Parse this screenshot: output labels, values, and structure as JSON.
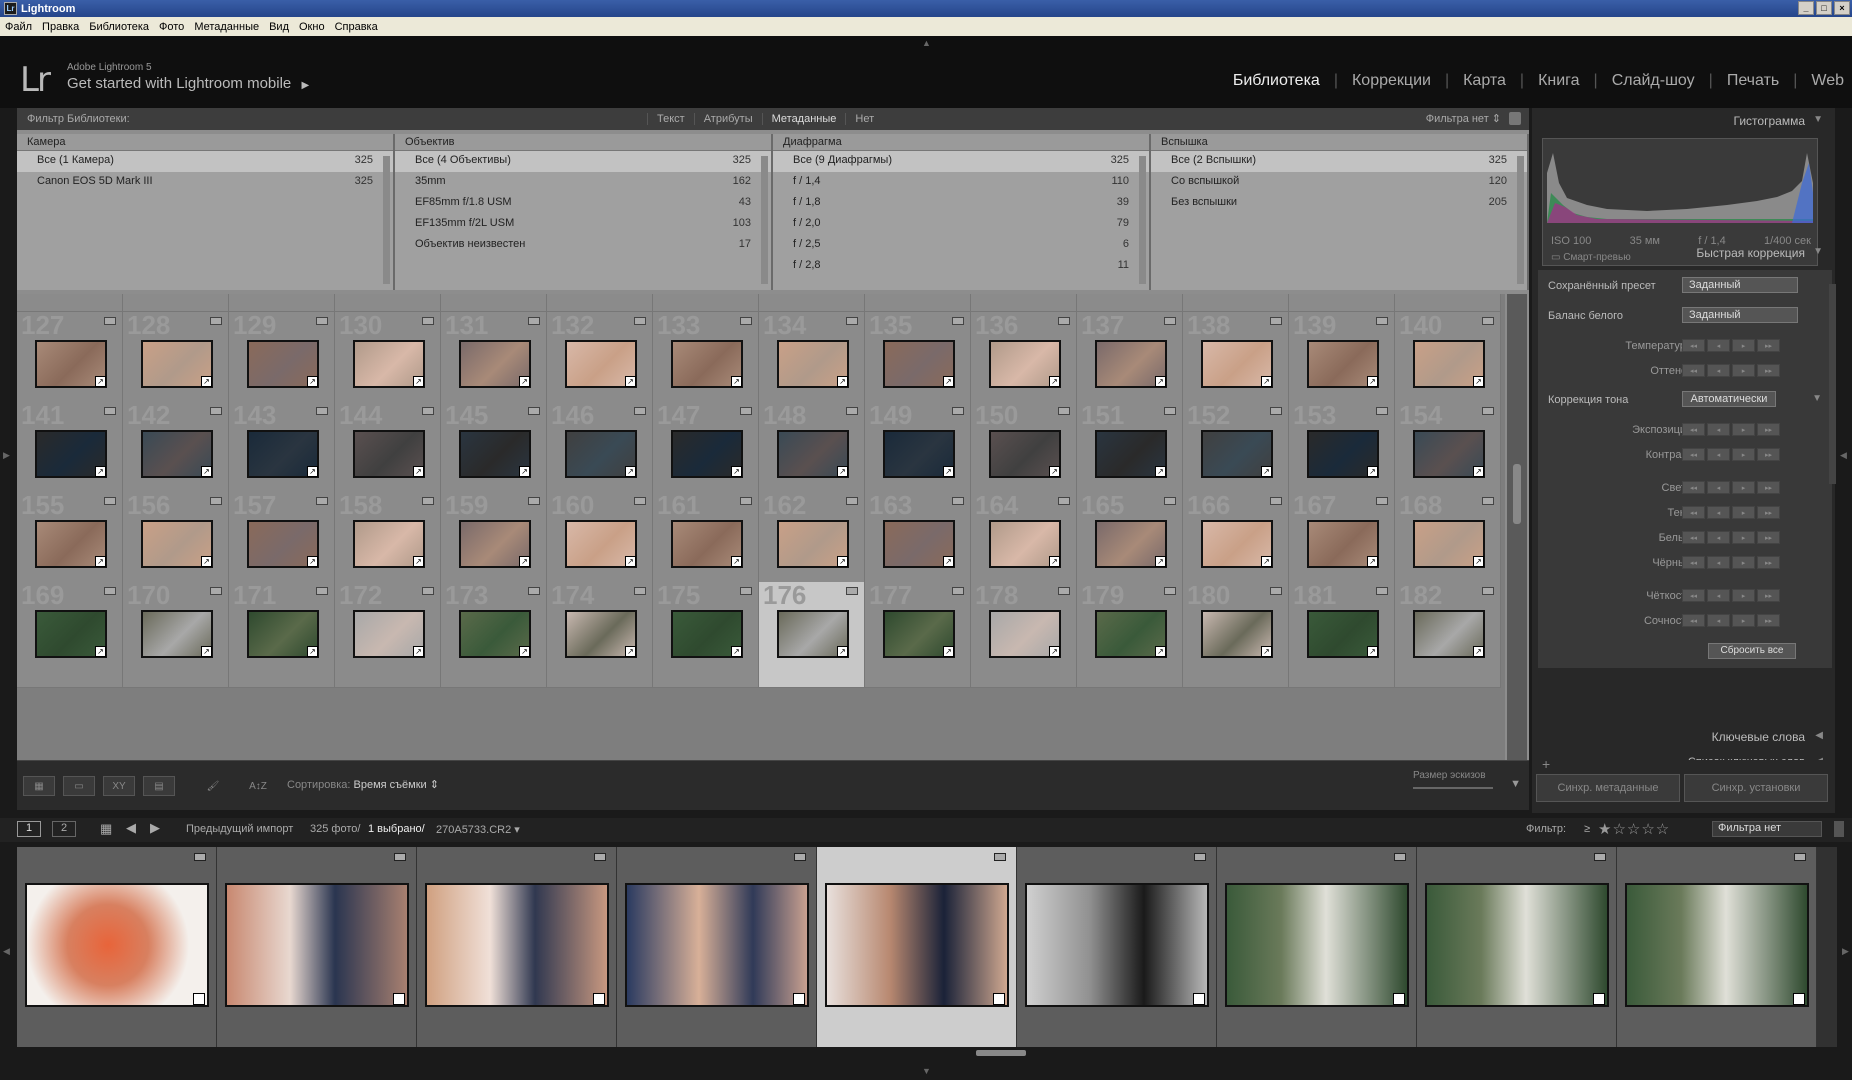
{
  "window": {
    "title": "Lightroom",
    "app_icon": "Lr"
  },
  "menu": [
    "Файл",
    "Правка",
    "Библиотека",
    "Фото",
    "Метаданные",
    "Вид",
    "Окно",
    "Справка"
  ],
  "identity": {
    "logo": "Lr",
    "product": "Adobe Lightroom 5",
    "tagline": "Get started with Lightroom mobile"
  },
  "modules": [
    "Библиотека",
    "Коррекции",
    "Карта",
    "Книга",
    "Слайд-шоу",
    "Печать",
    "Web"
  ],
  "filter_bar": {
    "title": "Фильтр Библиотеки:",
    "tabs": [
      "Текст",
      "Атрибуты",
      "Метаданные",
      "Нет"
    ],
    "active_tab": "Метаданные",
    "preset": "Фильтра нет ⇕"
  },
  "metadata_columns": [
    {
      "header": "Камера",
      "rows": [
        {
          "label": "Все (1 Камера)",
          "count": "325"
        },
        {
          "label": "Canon EOS 5D Mark III",
          "count": "325"
        }
      ]
    },
    {
      "header": "Объектив",
      "rows": [
        {
          "label": "Все (4 Объективы)",
          "count": "325"
        },
        {
          "label": "35mm",
          "count": "162"
        },
        {
          "label": "EF85mm f/1.8 USM",
          "count": "43"
        },
        {
          "label": "EF135mm f/2L USM",
          "count": "103"
        },
        {
          "label": "Объектив неизвестен",
          "count": "17"
        }
      ]
    },
    {
      "header": "Диафрагма",
      "rows": [
        {
          "label": "Все (9 Диафрагмы)",
          "count": "325"
        },
        {
          "label": "f / 1,4",
          "count": "110"
        },
        {
          "label": "f / 1,8",
          "count": "39"
        },
        {
          "label": "f / 2,0",
          "count": "79"
        },
        {
          "label": "f / 2,5",
          "count": "6"
        },
        {
          "label": "f / 2,8",
          "count": "11"
        }
      ]
    },
    {
      "header": "Вспышка",
      "rows": [
        {
          "label": "Все (2 Вспышки)",
          "count": "325"
        },
        {
          "label": "Со вспышкой",
          "count": "120"
        },
        {
          "label": "Без вспышки",
          "count": "205"
        }
      ]
    }
  ],
  "grid": {
    "rows": [
      {
        "numbers": [
          "",
          "",
          "",
          "",
          "",
          "",
          "",
          "",
          "",
          "",
          "",
          "",
          "",
          ""
        ],
        "tone": "mixed"
      },
      {
        "numbers": [
          "127",
          "128",
          "129",
          "130",
          "131",
          "132",
          "133",
          "134",
          "135",
          "136",
          "137",
          "138",
          "139",
          "140"
        ],
        "tone": "color"
      },
      {
        "numbers": [
          "141",
          "142",
          "143",
          "144",
          "145",
          "146",
          "147",
          "148",
          "149",
          "150",
          "151",
          "152",
          "153",
          "154"
        ],
        "tone": "dark"
      },
      {
        "numbers": [
          "155",
          "156",
          "157",
          "158",
          "159",
          "160",
          "161",
          "162",
          "163",
          "164",
          "165",
          "166",
          "167",
          "168"
        ],
        "tone": "color"
      },
      {
        "numbers": [
          "169",
          "170",
          "171",
          "172",
          "173",
          "174",
          "175",
          "176",
          "177",
          "178",
          "179",
          "180",
          "181",
          "182"
        ],
        "tone": "green"
      }
    ],
    "selected": "176"
  },
  "toolbar": {
    "sort_label": "Сортировка:",
    "sort_value": "Время съёмки ⇕",
    "thumb_size_label": "Размер эскизов"
  },
  "right_panel": {
    "histogram": {
      "title": "Гистограмма",
      "iso": "ISO 100",
      "focal": "35 мм",
      "aperture": "f / 1,4",
      "shutter": "1/400 сек",
      "smart_preview": "Смарт-превью"
    },
    "quick_develop": {
      "title": "Быстрая коррекция",
      "saved_preset_label": "Сохранённый пресет",
      "saved_preset_value": "Заданный",
      "wb_label": "Баланс белого",
      "wb_value": "Заданный",
      "temperature": "Температура",
      "tint": "Оттенок",
      "tone_label": "Коррекция тона",
      "auto_label": "Автоматически",
      "exposure": "Экспозиция",
      "contrast": "Контраст",
      "highlights": "Света",
      "shadows": "Тени",
      "whites": "Белые",
      "blacks": "Чёрные",
      "clarity": "Чёткость",
      "vibrance": "Сочность",
      "reset": "Сбросить все"
    },
    "keywords": "Ключевые слова",
    "keyword_list": "Список ключевых слов",
    "sync_metadata": "Синхр. метаданные",
    "sync_settings": "Синхр. установки"
  },
  "filmstrip_bar": {
    "screen1": "1",
    "screen2": "2",
    "source": "Предыдущий импорт",
    "count": "325 фото/",
    "selected": "1 выбрано/",
    "file": "270A5733.CR2 ▾",
    "filter_label": "Фильтр:",
    "filter_value": "Фильтра нет"
  },
  "filmstrip": [
    {
      "tone": "flowers"
    },
    {
      "tone": "couple_warm"
    },
    {
      "tone": "couple_warm2"
    },
    {
      "tone": "couple_close"
    },
    {
      "tone": "couple_selected"
    },
    {
      "tone": "couple_bw"
    },
    {
      "tone": "green"
    },
    {
      "tone": "green"
    },
    {
      "tone": "green"
    }
  ]
}
